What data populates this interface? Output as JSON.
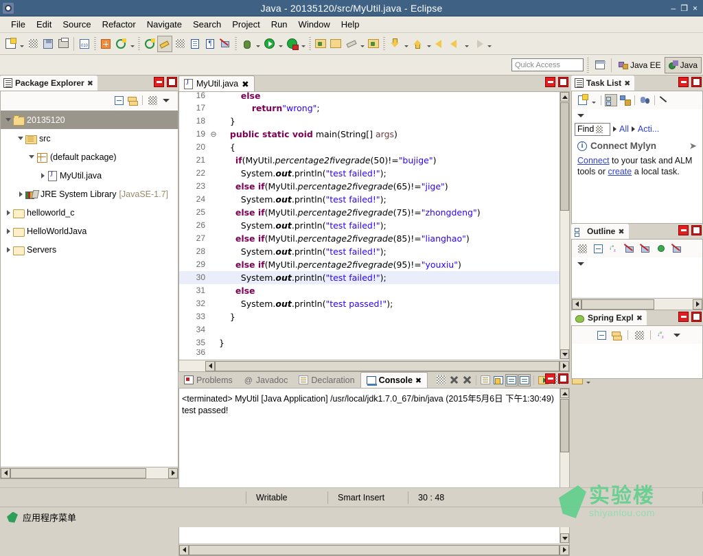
{
  "window": {
    "title": "Java - 20135120/src/MyUtil.java - Eclipse",
    "app_icon": "eclipse-icon",
    "minimize": "–",
    "restore": "❐",
    "close": "×"
  },
  "menubar": {
    "items": [
      "File",
      "Edit",
      "Source",
      "Refactor",
      "Navigate",
      "Search",
      "Project",
      "Run",
      "Window",
      "Help"
    ]
  },
  "toolbar": {
    "groups": [
      {
        "buttons": [
          {
            "name": "new-wizard",
            "icon": "new-file-icon",
            "dropdown": true,
            "selected": false
          },
          {
            "name": "save",
            "icon": "save-icon",
            "dropdown": false,
            "selected": false
          },
          {
            "name": "save-all",
            "icon": "save-all-icon",
            "dropdown": false,
            "selected": false
          },
          {
            "name": "print",
            "icon": "print-icon",
            "dropdown": false,
            "selected": false
          }
        ]
      },
      {
        "buttons": [
          {
            "name": "toggle-binary",
            "icon": "binary-icon",
            "dropdown": false,
            "selected": false
          }
        ]
      },
      {
        "buttons": [
          {
            "name": "new-java-package",
            "icon": "package-icon",
            "dropdown": false,
            "selected": false
          },
          {
            "name": "refresh-build",
            "icon": "build-icon",
            "dropdown": true,
            "selected": false
          }
        ]
      },
      {
        "buttons": [
          {
            "name": "open-type",
            "icon": "open-type-icon",
            "dropdown": false,
            "selected": false
          },
          {
            "name": "toggle-mark-occurrences",
            "icon": "marker-pen-icon",
            "dropdown": false,
            "selected": true
          },
          {
            "name": "skip-breakpoints",
            "icon": "skip-breakpoints-icon",
            "dropdown": false,
            "selected": false
          },
          {
            "name": "open-task",
            "icon": "task-book-icon",
            "dropdown": false,
            "selected": false
          },
          {
            "name": "show-whitespace",
            "icon": "pilcrow-icon",
            "dropdown": false,
            "selected": false
          },
          {
            "name": "toggle-annotations",
            "icon": "annotation-off-icon",
            "dropdown": false,
            "selected": false
          }
        ]
      },
      {
        "buttons": [
          {
            "name": "debug",
            "icon": "bug-icon",
            "dropdown": true,
            "selected": false
          },
          {
            "name": "run",
            "icon": "run-icon",
            "dropdown": true,
            "selected": false
          },
          {
            "name": "run-external",
            "icon": "run-lock-icon",
            "dropdown": true,
            "selected": false
          }
        ]
      },
      {
        "buttons": [
          {
            "name": "new-java-project",
            "icon": "java-project-icon",
            "dropdown": false,
            "selected": false
          },
          {
            "name": "new-folder",
            "icon": "folder-icon",
            "dropdown": false,
            "selected": false
          },
          {
            "name": "search",
            "icon": "brush-icon",
            "dropdown": true,
            "selected": false
          },
          {
            "name": "open-resource",
            "icon": "folder-open-icon",
            "dropdown": false,
            "selected": false
          }
        ]
      },
      {
        "buttons": [
          {
            "name": "next-annotation",
            "icon": "arrow-down-yellow-icon",
            "dropdown": true,
            "selected": false
          },
          {
            "name": "previous-annotation",
            "icon": "arrow-up-yellow-icon",
            "dropdown": true,
            "selected": false
          },
          {
            "name": "back",
            "icon": "back-arrow-icon",
            "dropdown": false,
            "selected": false
          },
          {
            "name": "forward",
            "icon": "forward-arrow-icon",
            "dropdown": true,
            "selected": false
          },
          {
            "name": "last-edit-location",
            "icon": "last-edit-icon",
            "dropdown": true,
            "selected": false
          }
        ]
      }
    ]
  },
  "quick_access": {
    "placeholder": "Quick Access",
    "value": "",
    "open_perspective_icon": "open-perspective-icon",
    "perspectives": [
      {
        "label": "Java EE",
        "icon": "java-ee-icon",
        "active": false
      },
      {
        "label": "Java",
        "icon": "java-perspective-icon",
        "active": true
      }
    ]
  },
  "package_explorer": {
    "title": "Package Explorer",
    "tab_icon": "package-explorer-icon",
    "close_label": "✖",
    "minimize_title": "Minimize",
    "maximize_title": "Maximize",
    "toolbar": [
      {
        "name": "collapse-all",
        "icon": "collapse-all-icon"
      },
      {
        "name": "link-with-editor",
        "icon": "link-editor-icon"
      },
      {
        "name": "view-menu-dots",
        "icon": "dotted-icon"
      },
      {
        "name": "view-menu",
        "icon": "view-menu-icon"
      }
    ],
    "tree": [
      {
        "label": "20135120",
        "sub": "",
        "indent": 0,
        "twisty": "down",
        "icon": "java-project-icon",
        "selected": true
      },
      {
        "label": "src",
        "sub": "",
        "indent": 1,
        "twisty": "down",
        "icon": "source-folder-icon",
        "selected": false
      },
      {
        "label": "(default package)",
        "sub": "",
        "indent": 2,
        "twisty": "down",
        "icon": "package-icon",
        "selected": false
      },
      {
        "label": "MyUtil.java",
        "sub": "",
        "indent": 3,
        "twisty": "right",
        "icon": "java-file-icon",
        "selected": false
      },
      {
        "label": "JRE System Library",
        "sub": "[JavaSE-1.7]",
        "indent": 1,
        "twisty": "right",
        "icon": "jre-library-icon",
        "selected": false
      },
      {
        "label": "helloworld_c",
        "sub": "",
        "indent": 0,
        "twisty": "right",
        "icon": "folder-closed-icon",
        "selected": false
      },
      {
        "label": "HelloWorldJava",
        "sub": "",
        "indent": 0,
        "twisty": "right",
        "icon": "folder-closed-icon",
        "selected": false
      },
      {
        "label": "Servers",
        "sub": "",
        "indent": 0,
        "twisty": "right",
        "icon": "folder-closed-icon",
        "selected": false
      }
    ]
  },
  "editor": {
    "tab": {
      "label": "MyUtil.java",
      "icon": "java-file-icon",
      "close_label": "✖"
    },
    "first_line_number": 16,
    "highlight_line": 30,
    "lines": [
      {
        "n": 16,
        "fold": "",
        "text": "        else",
        "clipped": true
      },
      {
        "n": 17,
        "fold": "",
        "text": "            return\"wrong\";"
      },
      {
        "n": 18,
        "fold": "",
        "text": "    }"
      },
      {
        "n": 19,
        "fold": "⊖",
        "text": "    public static void main(String[] args)"
      },
      {
        "n": 20,
        "fold": "",
        "text": "    {"
      },
      {
        "n": 21,
        "fold": "",
        "text": "      if(MyUtil.percentage2fivegrade(50)!=\"bujige\")"
      },
      {
        "n": 22,
        "fold": "",
        "text": "        System.out.println(\"test failed!\");"
      },
      {
        "n": 23,
        "fold": "",
        "text": "      else if(MyUtil.percentage2fivegrade(65)!=\"jige\")"
      },
      {
        "n": 24,
        "fold": "",
        "text": "        System.out.println(\"test failed!\");"
      },
      {
        "n": 25,
        "fold": "",
        "text": "      else if(MyUtil.percentage2fivegrade(75)!=\"zhongdeng\")"
      },
      {
        "n": 26,
        "fold": "",
        "text": "        System.out.println(\"test failed!\");"
      },
      {
        "n": 27,
        "fold": "",
        "text": "      else if(MyUtil.percentage2fivegrade(85)!=\"lianghao\")"
      },
      {
        "n": 28,
        "fold": "",
        "text": "        System.out.println(\"test failed!\");"
      },
      {
        "n": 29,
        "fold": "",
        "text": "      else if(MyUtil.percentage2fivegrade(95)!=\"youxiu\")"
      },
      {
        "n": 30,
        "fold": "",
        "text": "        System.out.println(\"test failed!\");"
      },
      {
        "n": 31,
        "fold": "",
        "text": "      else"
      },
      {
        "n": 32,
        "fold": "",
        "text": "        System.out.println(\"test passed!\");"
      },
      {
        "n": 33,
        "fold": "",
        "text": "    }"
      },
      {
        "n": 34,
        "fold": "",
        "text": ""
      },
      {
        "n": 35,
        "fold": "",
        "text": "}"
      },
      {
        "n": 36,
        "fold": "",
        "text": "",
        "clipped": true
      }
    ]
  },
  "console_panel": {
    "tabs": [
      {
        "label": "Problems",
        "icon": "problems-icon",
        "active": false
      },
      {
        "label": "Javadoc",
        "icon": "javadoc-icon",
        "active": false
      },
      {
        "label": "Declaration",
        "icon": "declaration-icon",
        "active": false
      },
      {
        "label": "Console",
        "icon": "console-icon",
        "active": true,
        "close_label": "✖"
      }
    ],
    "toolbar": [
      {
        "name": "terminate-all",
        "icon": "dotted-icon",
        "selected": false
      },
      {
        "name": "remove-launch",
        "icon": "remove-x-icon",
        "selected": false
      },
      {
        "name": "remove-all-terminated",
        "icon": "remove-all-x-icon",
        "selected": false
      },
      {
        "name": "clear-console",
        "icon": "clear-console-icon",
        "selected": false
      },
      {
        "name": "scroll-lock",
        "icon": "scroll-lock-icon",
        "selected": false
      },
      {
        "name": "show-console-on-output",
        "icon": "show-console-icon",
        "selected": true
      },
      {
        "name": "show-console-on-error",
        "icon": "show-console-error-icon",
        "selected": true
      },
      {
        "name": "pin-console",
        "icon": "pin-console-icon",
        "selected": false
      },
      {
        "name": "display-selected-console",
        "icon": "display-console-icon",
        "selected": false,
        "dropdown": true
      },
      {
        "name": "open-console",
        "icon": "open-console-icon",
        "selected": false,
        "dropdown": true
      }
    ],
    "output": {
      "header": "<terminated> MyUtil [Java Application] /usr/local/jdk1.7.0_67/bin/java (2015年5月6日 下午1:30:49)",
      "lines": [
        "test passed!"
      ]
    }
  },
  "task_list": {
    "title": "Task List",
    "tab_icon": "task-list-icon",
    "close_label": "✖",
    "toolbar": [
      {
        "name": "new-task",
        "icon": "new-task-icon",
        "dropdown": true,
        "selected": false
      },
      {
        "name": "categorized-presentation",
        "icon": "categorized-icon",
        "selected": true
      },
      {
        "name": "scheduled-presentation",
        "icon": "scheduled-icon",
        "selected": false
      },
      {
        "name": "synchronize-changed",
        "icon": "synchronize-icon",
        "selected": false
      },
      {
        "name": "focus-on-workweek",
        "icon": "focus-arrow-icon",
        "selected": false
      },
      {
        "name": "view-menu",
        "icon": "view-menu-icon",
        "selected": false
      }
    ],
    "find": {
      "label": "Find",
      "icon": "find-icon",
      "filters": [
        "All",
        "Acti..."
      ]
    },
    "mylyn": {
      "icon": "info-icon",
      "title": "Connect Mylyn",
      "text_parts": [
        {
          "type": "link",
          "text": "Connect"
        },
        {
          "type": "text",
          "text": " to your task and ALM tools or "
        },
        {
          "type": "link",
          "text": "create"
        },
        {
          "type": "text",
          "text": " a local task."
        }
      ],
      "expand_icon": "expand-arrow-icon"
    }
  },
  "outline": {
    "title": "Outline",
    "tab_icon": "outline-icon",
    "close_label": "✖",
    "toolbar": [
      {
        "name": "focus-on-active-task",
        "icon": "dotted-icon"
      },
      {
        "name": "collapse-all",
        "icon": "collapse-all-icon"
      },
      {
        "name": "sort",
        "icon": "sort-az-icon"
      },
      {
        "name": "hide-fields",
        "icon": "hide-fields-icon"
      },
      {
        "name": "hide-static-fields",
        "icon": "hide-static-icon"
      },
      {
        "name": "hide-non-public",
        "icon": "green-dot-icon"
      },
      {
        "name": "hide-local-types",
        "icon": "hide-local-icon"
      },
      {
        "name": "view-menu",
        "icon": "view-menu-icon"
      }
    ],
    "content": []
  },
  "spring_explorer": {
    "title": "Spring Expl",
    "tab_icon": "spring-icon",
    "close_label": "✖",
    "toolbar": [
      {
        "name": "collapse-all",
        "icon": "collapse-all-icon"
      },
      {
        "name": "link-with-editor",
        "icon": "link-editor-icon"
      },
      {
        "name": "filter",
        "icon": "dotted-icon"
      },
      {
        "name": "sort",
        "icon": "sort-az-icon"
      },
      {
        "name": "view-menu",
        "icon": "view-menu-icon"
      }
    ]
  },
  "status_bar": {
    "writable": "Writable",
    "insert_mode": "Smart Insert",
    "cursor_position": "30 : 48"
  },
  "taskbar": {
    "icon": "leaf-icon",
    "label": "应用程序菜单"
  },
  "watermark": {
    "cn": "实验楼",
    "en": "shiyanlou.com",
    "color": "#63cf8e"
  },
  "colors": {
    "titlebar": "#3f6184",
    "chrome": "#ece9e1",
    "workspace": "#d6d2c8",
    "selection": "#9a968c",
    "keyword": "#7f0055",
    "string": "#2a00ff",
    "link": "#2b3fd0",
    "highlight_line": "#eaeefa",
    "close_button": "#e02020"
  }
}
